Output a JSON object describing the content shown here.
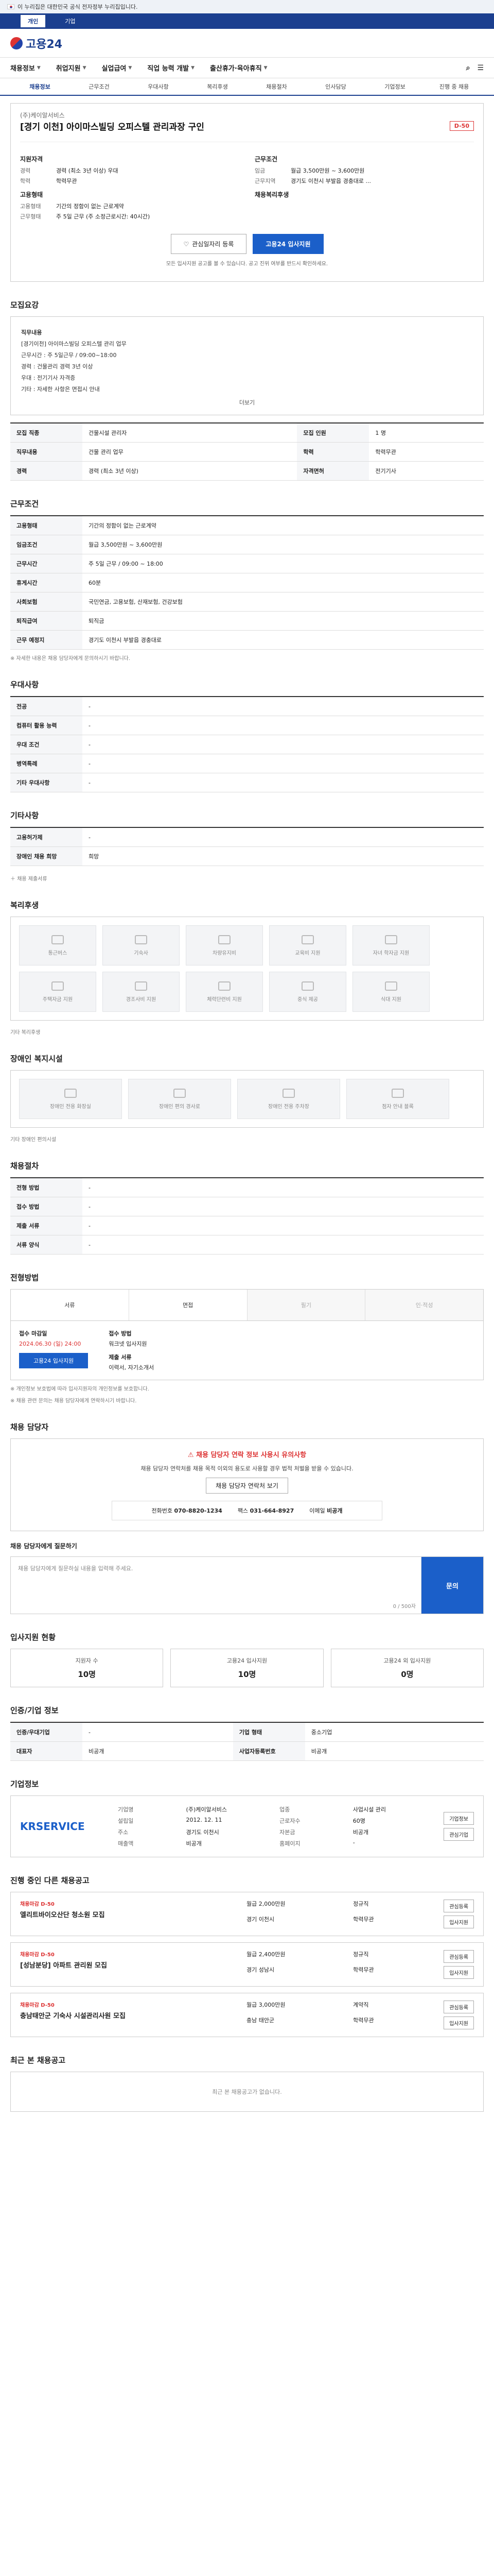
{
  "gov": {
    "notice": "이 누리집은 대한민국 공식 전자정부 누리집입니다."
  },
  "topnav": [
    "개인",
    "기업"
  ],
  "logo": {
    "text": "고용24"
  },
  "gnb": {
    "items": [
      "채용정보",
      "취업지원",
      "실업급여",
      "직업 능력 개발",
      "출산휴가·육아휴직"
    ]
  },
  "subtabs": [
    "채용정보",
    "근무조건",
    "우대사항",
    "복리후생",
    "채용절차",
    "인사담당",
    "기업정보",
    "진행 중 채용"
  ],
  "job": {
    "company": "(주)케이알서비스",
    "title": "[경기 이천] 아이마스빌딩 오피스텔 관리과장 구인",
    "dday": "D-50",
    "left_section": "지원자격",
    "left_rows": [
      {
        "k": "경력",
        "v": "경력 (최소 3년 이상) 우대"
      },
      {
        "k": "학력",
        "v": "학력무관"
      }
    ],
    "left_section2": "고용형태",
    "left_rows2": [
      {
        "k": "고용형태",
        "v": "기간의 정함이 없는 근로계약"
      },
      {
        "k": "근무형태",
        "v": "주 5일 근무 (주 소정근로시간: 40시간)"
      }
    ],
    "right_section": "근무조건",
    "right_rows": [
      {
        "k": "임금",
        "v": "월급 3,500만원 ~ 3,600만원"
      },
      {
        "k": "근무지역",
        "v": "경기도 이천시 부발읍 경충대로 ..."
      }
    ],
    "right_section2": "채용복리후생",
    "btn_scrap": "관심일자리 등록",
    "btn_apply": "고용24 입사지원",
    "note": "모든 입사지원 공고를 볼 수 있습니다. 공고 진위 여부를 반드시 확인하세요."
  },
  "recruit": {
    "title": "모집요강",
    "lines": [
      "직무내용",
      "[경기이천] 아이마스빌딩 오피스텔 관리 업무",
      "근무시간 : 주 5일근무 / 09:00~18:00",
      "경력 : 건물관리 경력 3년 이상",
      "우대 : 전기기사 자격증",
      "기타 : 자세한 사항은 면접시 안내"
    ],
    "toggle": "더보기",
    "rows": [
      {
        "k": "모집 직종",
        "v": "건물시설 관리자"
      },
      {
        "k": "모집 인원",
        "v": "1 명"
      },
      {
        "k": "직무내용",
        "v": "건물 관리 업무"
      },
      {
        "k": "학력",
        "v": "학력무관"
      },
      {
        "k": "경력",
        "v": "경력 (최소 3년 이상)"
      },
      {
        "k": "자격면허",
        "v": "전기기사"
      }
    ]
  },
  "work": {
    "title": "근무조건",
    "rows": [
      {
        "k": "고용형태",
        "v": "기간의 정함이 없는 근로계약"
      },
      {
        "k": "임금조건",
        "v": "월급 3,500만원 ~ 3,600만원"
      },
      {
        "k": "근무시간",
        "v": "주 5일 근무 / 09:00 ~ 18:00"
      },
      {
        "k": "휴게시간",
        "v": "60분"
      },
      {
        "k": "사회보험",
        "v": "국민연금, 고용보험, 산재보험, 건강보험"
      },
      {
        "k": "퇴직급여",
        "v": "퇴직금"
      },
      {
        "k": "근무 예정지",
        "v": "경기도 이천시 부발읍 경충대로"
      }
    ],
    "note": "※ 자세한 내용은 채용 담당자에게 문의하시기 바랍니다."
  },
  "pref": {
    "title": "우대사항",
    "rows": [
      {
        "k": "전공",
        "v": "-"
      },
      {
        "k": "컴퓨터 활용 능력",
        "v": "-"
      },
      {
        "k": "우대 조건",
        "v": "-"
      },
      {
        "k": "병역특례",
        "v": "-"
      },
      {
        "k": "기타 우대사항",
        "v": "-"
      }
    ]
  },
  "other": {
    "title": "기타사항",
    "rows": [
      {
        "k": "고용허가제",
        "v": "-"
      },
      {
        "k": "장애인 채용 희망",
        "v": "희망"
      }
    ],
    "more": "채용 제출서류"
  },
  "welfare": {
    "title": "복리후생",
    "items": [
      "통근버스",
      "기숙사",
      "차량유지비",
      "교육비 지원",
      "자녀 학자금 지원",
      "주택자금 지원",
      "경조사비 지원",
      "체력단련비 지원",
      "중식 제공",
      "식대 지원"
    ],
    "note": "기타 복리후생"
  },
  "disabled": {
    "title": "장애인 복지시설",
    "items": [
      "장애인 전용 화장실",
      "장애인 편의 경사로",
      "장애인 전용 주차장",
      "점자 안내 블록"
    ],
    "note": "기타 장애인 편의시설"
  },
  "process": {
    "title": "채용절차",
    "rows": [
      {
        "k": "전형 방법",
        "v": "-"
      },
      {
        "k": "접수 방법",
        "v": "-"
      },
      {
        "k": "제출 서류",
        "v": "-"
      },
      {
        "k": "서류 양식",
        "v": "-"
      }
    ]
  },
  "apply": {
    "title": "전형방법",
    "steps": [
      "서류",
      "면접",
      "필기",
      "인·적성"
    ],
    "period_k": "접수 마감일",
    "period_v": "2024.06.30 (일) 24:00",
    "method_k": "접수 방법",
    "method_v": "워크넷 입사지원",
    "docs_k": "제출 서류",
    "docs_v": "이력서, 자기소개서",
    "btn": "고용24 입사지원",
    "notes": [
      "※ 개인정보 보호법에 따라 입사지원자의 개인정보를 보호합니다.",
      "※ 채용 관련 문의는 채용 담당자에게 연락하시기 바랍니다."
    ]
  },
  "contact": {
    "title": "채용 담당자",
    "warn_title": "채용 담당자 연락 정보 사용시 유의사항",
    "warn_sub": "채용 담당자 연락처를 채용 목적 이외의 용도로 사용할 경우 법적 처벌을 받을 수 있습니다.",
    "btn": "채용 담당자 연락처 보기",
    "phone_k": "전화번호",
    "phone_v": "070-8820-1234",
    "fax_k": "팩스",
    "fax_v": "031-664-8927",
    "email_k": "이메일",
    "email_v": "비공개"
  },
  "inquiry": {
    "title": "채용 담당자에게 질문하기",
    "placeholder": "채용 담당자에게 질문하실 내용을 입력해 주세요.",
    "count": "0 / 500자",
    "btn": "문의"
  },
  "stats": {
    "title": "입사지원 현황",
    "items": [
      {
        "k": "지원자 수",
        "v": "10명"
      },
      {
        "k": "고용24 입사지원",
        "v": "10명"
      },
      {
        "k": "고용24 외 입사지원",
        "v": "0명"
      }
    ]
  },
  "info": {
    "title": "인증/기업 정보",
    "rows": [
      {
        "k": "인증/우대기업",
        "v": "-"
      },
      {
        "k": "기업 형태",
        "v": "중소기업"
      },
      {
        "k": "대표자",
        "v": "비공개"
      },
      {
        "k": "사업자등록번호",
        "v": "비공개"
      }
    ]
  },
  "company": {
    "title": "기업정보",
    "logo": "KRSERVICE",
    "grid": [
      {
        "k": "기업명",
        "v": "(주)케이알서비스"
      },
      {
        "k": "업종",
        "v": "사업시설 관리"
      },
      {
        "k": "설립일",
        "v": "2012. 12. 11"
      },
      {
        "k": "근로자수",
        "v": "60명"
      },
      {
        "k": "주소",
        "v": "경기도 이천시"
      },
      {
        "k": "자본금",
        "v": "비공개"
      },
      {
        "k": "매출액",
        "v": "비공개"
      },
      {
        "k": "홈페이지",
        "v": "-"
      }
    ],
    "btn1": "기업정보",
    "btn2": "관심기업"
  },
  "others": {
    "title": "진행 중인 다른 채용공고",
    "items": [
      {
        "tag": "채용마감 D-50",
        "title": "엘리트바이오산단 청소원 모집",
        "pay": "월급 2,000만원",
        "type": "정규직",
        "area": "경기 이천시",
        "edu": "학력무관"
      },
      {
        "tag": "채용마감 D-50",
        "title": "[성남분당] 아파트 관리원 모집",
        "pay": "월급 2,400만원",
        "type": "정규직",
        "area": "경기 성남시",
        "edu": "학력무관"
      },
      {
        "tag": "채용마감 D-50",
        "title": "충남태안군 기숙사 시설관리사원 모집",
        "pay": "월급 3,000만원",
        "type": "계약직",
        "area": "충남 태안군",
        "edu": "학력무관"
      }
    ],
    "btn_scrap": "관심등록",
    "btn_apply": "입사지원"
  },
  "recent": {
    "title": "최근 본 채용공고",
    "empty": "최근 본 채용공고가 없습니다."
  }
}
